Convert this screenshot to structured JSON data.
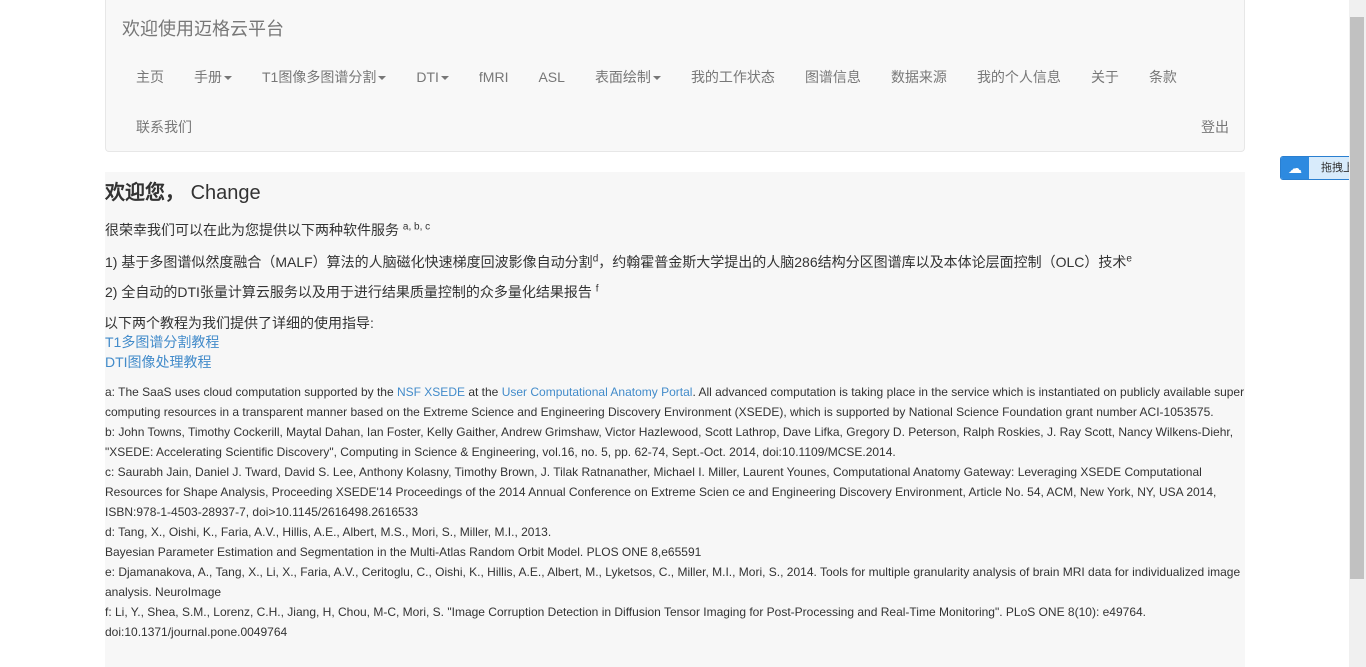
{
  "navbar": {
    "brand": "欢迎使用迈格云平台",
    "items": [
      {
        "label": "主页",
        "dropdown": false
      },
      {
        "label": "手册",
        "dropdown": true
      },
      {
        "label": "T1图像多图谱分割",
        "dropdown": true
      },
      {
        "label": "DTI",
        "dropdown": true
      },
      {
        "label": "fMRI",
        "dropdown": false
      },
      {
        "label": "ASL",
        "dropdown": false
      },
      {
        "label": "表面绘制",
        "dropdown": true
      },
      {
        "label": "我的工作状态",
        "dropdown": false
      },
      {
        "label": "图谱信息",
        "dropdown": false
      },
      {
        "label": "数据来源",
        "dropdown": false
      },
      {
        "label": "我的个人信息",
        "dropdown": false
      },
      {
        "label": "关于",
        "dropdown": false
      },
      {
        "label": "条款",
        "dropdown": false
      },
      {
        "label": "联系我们",
        "dropdown": false
      }
    ],
    "logout": "登出"
  },
  "main": {
    "welcome": "欢迎您，",
    "username": "Change",
    "intro": "很荣幸我们可以在此为您提供以下两种软件服务",
    "intro_sup": "a, b, c",
    "item1_a": "1) 基于多图谱似然度融合（MALF）算法的人脑磁化快速梯度回波影像自动分割",
    "item1_sup1": "d",
    "item1_b": "，约翰霍普金斯大学提出的人脑286结构分区图谱库以及本体论层面控制（OLC）技术",
    "item1_sup2": "e",
    "item2": "2) 全自动的DTI张量计算云服务以及用于进行结果质量控制的众多量化结果报告",
    "item2_sup": "f",
    "tutorial_intro": "以下两个教程为我们提供了详细的使用指导:",
    "tutorial_links": [
      "T1多图谱分割教程",
      "DTI图像处理教程"
    ],
    "notes": {
      "a1": "a: The SaaS uses cloud computation supported by the ",
      "a_link1": "NSF XSEDE",
      "a2": " at the ",
      "a_link2": "User Computational Anatomy Portal",
      "a3": ". All advanced computation is taking place in the service which is instantiated on publicly available super computing resources in a transparent manner based on the Extreme Science and Engineering Discovery Environment (XSEDE), which is supported by National Science Foundation grant number ACI-1053575.",
      "b": "b: John Towns, Timothy Cockerill, Maytal Dahan, Ian Foster, Kelly Gaither, Andrew Grimshaw, Victor Hazlewood, Scott Lathrop, Dave Lifka, Gregory D. Peterson, Ralph Roskies, J. Ray Scott, Nancy Wilkens-Diehr, \"XSEDE: Accelerating Scientific Discovery\", Computing in Science & Engineering, vol.16, no. 5, pp. 62-74, Sept.-Oct. 2014, doi:10.1109/MCSE.2014.",
      "c": "c: Saurabh Jain, Daniel J. Tward, David S. Lee, Anthony Kolasny, Timothy Brown, J. Tilak Ratnanather, Michael I. Miller, Laurent Younes, Computational Anatomy Gateway: Leveraging XSEDE Computational Resources for Shape Analysis, Proceeding XSEDE'14 Proceedings of the 2014 Annual Conference on Extreme Scien ce and Engineering Discovery Environment, Article No. 54, ACM, New York, NY, USA 2014, ISBN:978-1-4503-28937-7, doi>10.1145/2616498.2616533",
      "d1": "d: Tang, X., Oishi, K., Faria, A.V., Hillis, A.E., Albert, M.S., Mori, S., Miller, M.I., 2013.",
      "d2": "Bayesian Parameter Estimation and Segmentation in the Multi-Atlas Random Orbit Model. PLOS ONE 8,e65591",
      "e": "e: Djamanakova, A., Tang, X., Li, X., Faria, A.V., Ceritoglu, C., Oishi, K., Hillis, A.E., Albert, M., Lyketsos, C., Miller, M.I., Mori, S., 2014. Tools for multiple granularity analysis of brain MRI data for individualized image analysis. NeuroImage",
      "f": "f: Li, Y., Shea, S.M., Lorenz, C.H., Jiang, H, Chou, M-C, Mori, S. \"Image Corruption Detection in Diffusion Tensor Imaging for Post-Processing and Real-Time Monitoring\". PLoS ONE 8(10): e49764. doi:10.1371/journal.pone.0049764"
    }
  },
  "upload_widget": {
    "label": "拖拽上传"
  },
  "colors": {
    "link": "#428bca",
    "upload": "#2d8ae0"
  }
}
